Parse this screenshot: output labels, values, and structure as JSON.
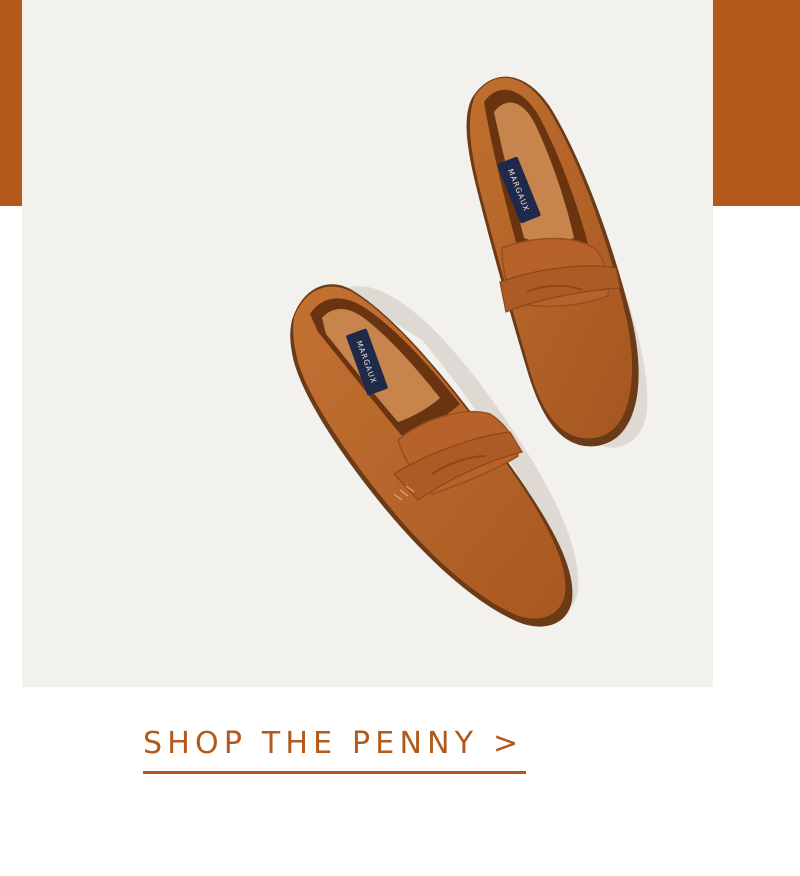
{
  "hero": {
    "brand_label_left_shoe": "MARGAUX",
    "brand_label_right_shoe": "MARGAUX",
    "product_image_name": "penny-loafer-pair"
  },
  "cta": {
    "label": "SHOP THE PENNY >"
  },
  "colors": {
    "accent": "#b35a1b",
    "panel_background": "#f3f1ee",
    "page_background": "#ffffff",
    "suede": "#b9652a",
    "label_navy": "#1f2a4a"
  }
}
